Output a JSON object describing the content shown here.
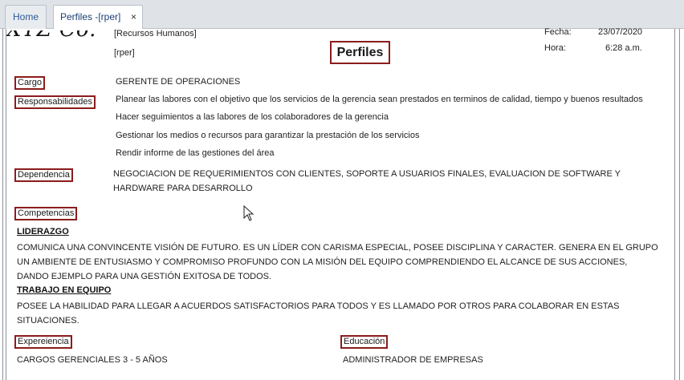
{
  "tabs": [
    {
      "label": "Home"
    },
    {
      "label": "Perfiles -[rper]",
      "close": "×"
    }
  ],
  "report": {
    "logo_text": "XYZ Co.",
    "department": "[Recursos Humanos]",
    "code": "[rper]",
    "title": "Perfiles",
    "fecha_label": "Fecha:",
    "fecha_value": "23/07/2020",
    "hora_label": "Hora:",
    "hora_value": "6:28 a.m.",
    "cargo_label": "Cargo",
    "cargo_value": "GERENTE DE OPERACIONES",
    "responsabilidades_label": "Responsabilidades",
    "responsabilidades": [
      "Planear las labores con el objetivo que los servicios de la gerencia sean prestados en terminos de calidad, tiempo y buenos resultados",
      "Hacer seguimientos a las labores de los colaboradores de la gerencia",
      "Gestionar los medios o recursos para garantizar la prestación de los servicios",
      "Rendir informe de las gestiones del área"
    ],
    "dependencia_label": "Dependencia",
    "dependencia_value": "NEGOCIACION DE REQUERIMIENTOS CON CLIENTES, SOPORTE A USUARIOS FINALES, EVALUACION DE SOFTWARE Y HARDWARE PARA DESARROLLO",
    "competencias_label": "Competencias",
    "competencias": [
      {
        "name": "LIDERAZGO",
        "description": "COMUNICA UNA CONVINCENTE VISIÓN DE FUTURO. ES UN LÍDER CON CARISMA ESPECIAL, POSEE DISCIPLINA Y CARACTER. GENERA EN EL GRUPO  UN AMBIENTE DE ENTUSIASMO Y COMPROMISO PROFUNDO CON LA MISIÓN DEL EQUIPO COMPRENDIENDO EL ALCANCE DE SUS ACCIONES, DANDO EJEMPLO PARA UNA GESTIÓN EXITOSA DE TODOS."
      },
      {
        "name": "TRABAJO EN EQUIPO",
        "description": "POSEE LA HABILIDAD PARA LLEGAR A ACUERDOS SATISFACTORIOS PARA TODOS Y ES LLAMADO POR OTROS PARA COLABORAR EN ESTAS SITUACIONES."
      }
    ],
    "experiencia_label": "Expereiencia",
    "experiencia_value": "CARGOS GERENCIALES 3 - 5 AÑOS",
    "educacion_label": "Educación",
    "educacion_value": "ADMINISTRADOR DE EMPRESAS"
  },
  "colors": {
    "label_border": "#8b1c1c",
    "tab_text": "#2a5a9a"
  }
}
